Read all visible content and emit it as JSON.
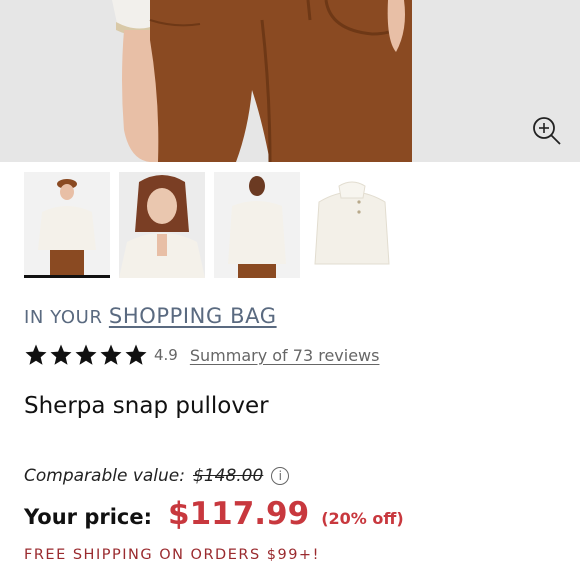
{
  "thumbnails": [
    {
      "alt": "front-view-with-hat"
    },
    {
      "alt": "collar-closeup"
    },
    {
      "alt": "back-view"
    },
    {
      "alt": "flat-product-view"
    }
  ],
  "bag": {
    "prefix": "IN YOUR",
    "link": "SHOPPING BAG"
  },
  "rating": {
    "stars": 5,
    "value": "4.9",
    "reviews_link": "Summary of 73 reviews"
  },
  "product": {
    "title": "Sherpa snap pullover"
  },
  "pricing": {
    "comparable_label": "Comparable value:",
    "comparable_price": "$148.00",
    "info_icon": "i",
    "your_price_label": "Your price:",
    "price": "$117.99",
    "discount": "(20% off)"
  },
  "shipping": {
    "text": "FREE SHIPPING ON ORDERS $99+!"
  },
  "colors": {
    "sale_red": "#c8383e",
    "link_slate": "#5a6a80",
    "shipping_red": "#9a2a2e",
    "pants_brown": "#8a4a22"
  }
}
